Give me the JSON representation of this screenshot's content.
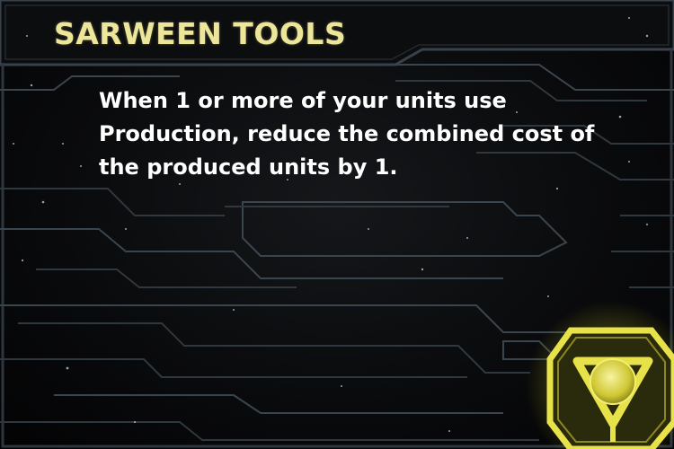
{
  "card": {
    "title": "SARWEEN TOOLS",
    "text": "When 1 or more of your units use Production, reduce the combined cost of the produced units by 1.",
    "emblem_icon": "cybernetic-technology-icon",
    "colors": {
      "title": "#ece59a",
      "text": "#ffffff",
      "emblem": "#e8e24a",
      "circuit": "#3f4a52"
    }
  }
}
